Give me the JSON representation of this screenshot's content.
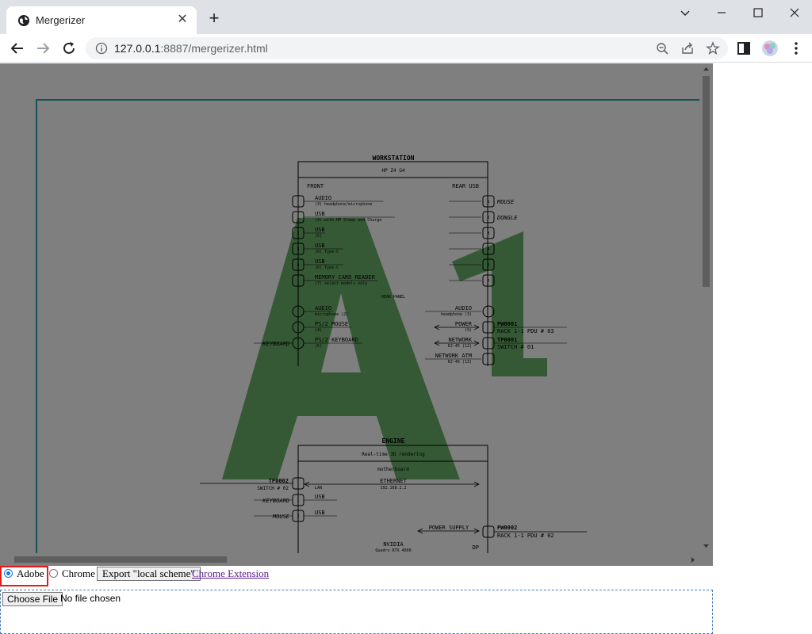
{
  "browser": {
    "tab_title": "Mergerizer",
    "url_host": "127.0.0.1",
    "url_rest": ":8887/mergerizer.html"
  },
  "diagram": {
    "workstation": {
      "title": "WORKSTATION",
      "model": "HP Z4 G4",
      "front_label": "FRONT",
      "rear_usb_label": "REAR USB",
      "rear_panel_label": "REAR PANEL",
      "front_ports": [
        {
          "id": "",
          "name": "AUDIO",
          "detail": "(3) headphone/microphone"
        },
        {
          "id": "1",
          "name": "USB",
          "detail": "(4) with HP Sleep and Charge"
        },
        {
          "id": "2",
          "name": "USB",
          "detail": "(5)"
        },
        {
          "id": "3",
          "name": "USB",
          "detail": "(6) Type-C"
        },
        {
          "id": "4",
          "name": "USB",
          "detail": "(6) Type-C"
        },
        {
          "id": "",
          "name": "MEMORY CARD READER",
          "detail": "(7) select models only"
        }
      ],
      "rear_usb_ports": [
        {
          "id": "1",
          "device": "MOUSE"
        },
        {
          "id": "2",
          "device": "DONGLE"
        },
        {
          "id": "3",
          "device": ""
        },
        {
          "id": "4",
          "device": ""
        },
        {
          "id": "5",
          "device": ""
        },
        {
          "id": "6",
          "device": ""
        }
      ],
      "rear_left_ports": [
        {
          "name": "AUDIO",
          "detail": "microphone (2)",
          "device": ""
        },
        {
          "name": "PS/2 MOUSE",
          "detail": "(4)",
          "device": ""
        },
        {
          "name": "PS/2 KEYBOARD",
          "detail": "(5)",
          "device": "KEYBOARD"
        }
      ],
      "rear_right_ports": [
        {
          "name": "AUDIO",
          "detail": "headphone (3)",
          "target": "",
          "target_detail": ""
        },
        {
          "name": "POWER",
          "detail": "(9)",
          "target": "PW0001",
          "target_detail": "RACK 1-1 PDU # 03"
        },
        {
          "name": "NETWORK",
          "detail": "RJ-45 (12)",
          "target": "TP0001",
          "target_detail": "SWITCH # 01"
        },
        {
          "name": "NETWORK ATM",
          "detail": "RJ-45 (13)",
          "target": "",
          "target_detail": ""
        }
      ]
    },
    "engine": {
      "title": "ENGINE",
      "subtitle": "Real-time 3D rendering",
      "board_label": "motherboard",
      "lan": {
        "target": "TP0002",
        "target_detail": "SWITCH # 02",
        "port": "LAN",
        "name": "ETHERNET",
        "detail": "192.168.2.2"
      },
      "usb": [
        {
          "id": "1",
          "name": "USB",
          "device": "KEYBOARD"
        },
        {
          "id": "2",
          "name": "USB",
          "device": "MOUSE"
        }
      ],
      "power": {
        "name": "POWER SUPPLY",
        "target": "PW0002",
        "target_detail": "RACK 1-1 PDU # 02"
      },
      "gpu": {
        "name": "NVIDIA",
        "detail": "Quadro RTX 4000",
        "port": "DP"
      }
    },
    "watermark": "A1",
    "watermark_color": "#3a9a3a"
  },
  "controls": {
    "adobe_label": "Adobe",
    "adobe_checked": true,
    "chrome_label": "Chrome",
    "export_label": "Export \"local scheme\"",
    "extension_link": "Chrome Extension"
  },
  "file_input": {
    "button_label": "Choose File",
    "status": "No file chosen"
  }
}
